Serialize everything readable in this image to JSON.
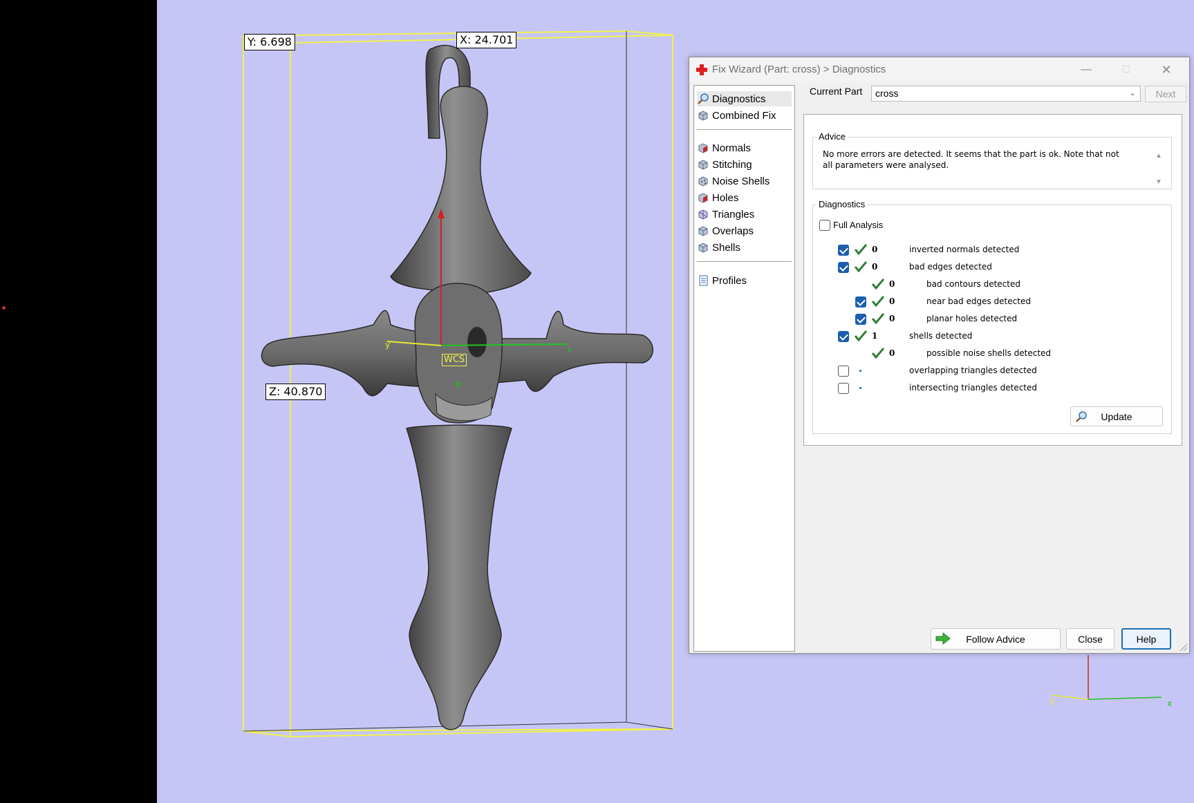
{
  "viewport": {
    "dim_y": "Y: 6.698",
    "dim_x": "X: 24.701",
    "dim_z": "Z: 40.870",
    "wcs_label": "WCS",
    "axis_y": "y",
    "axis_x": "x",
    "mini_axis_x": "x",
    "mini_axis_y": "y"
  },
  "dialog": {
    "title": "Fix Wizard (Part: cross) > Diagnostics",
    "window_buttons": {
      "minimize": "—",
      "maximize": "□",
      "close": "✕"
    }
  },
  "sidebar": {
    "items": [
      {
        "label": "Diagnostics",
        "icon": "magnifier-icon",
        "selected": true
      },
      {
        "label": "Combined Fix",
        "icon": "combined-fix-icon"
      },
      {
        "label": "Normals",
        "icon": "normals-icon"
      },
      {
        "label": "Stitching",
        "icon": "stitching-icon"
      },
      {
        "label": "Noise Shells",
        "icon": "noise-shells-icon"
      },
      {
        "label": "Holes",
        "icon": "holes-icon"
      },
      {
        "label": "Triangles",
        "icon": "triangles-icon"
      },
      {
        "label": "Overlaps",
        "icon": "overlaps-icon"
      },
      {
        "label": "Shells",
        "icon": "shells-icon"
      },
      {
        "label": "Profiles",
        "icon": "profiles-icon"
      }
    ]
  },
  "top": {
    "current_part_label": "Current Part",
    "current_part_value": "cross",
    "next_label": "Next"
  },
  "advice": {
    "title": "Advice",
    "text": "No more errors are detected. It seems that the part is ok. Note that not all parameters were analysed."
  },
  "diagnostics": {
    "title": "Diagnostics",
    "full_analysis_label": "Full Analysis",
    "full_analysis_checked": false,
    "rows": [
      {
        "checkbox": "checked",
        "status": "ok",
        "count": "0",
        "label": "inverted normals detected",
        "indent": 0
      },
      {
        "checkbox": "checked",
        "status": "ok",
        "count": "0",
        "label": "bad edges detected",
        "indent": 0
      },
      {
        "checkbox": "none",
        "status": "ok",
        "count": "0",
        "label": "bad contours detected",
        "indent": 1
      },
      {
        "checkbox": "checked",
        "status": "ok",
        "count": "0",
        "label": "near bad edges detected",
        "indent": 1
      },
      {
        "checkbox": "checked",
        "status": "ok",
        "count": "0",
        "label": "planar holes detected",
        "indent": 1
      },
      {
        "checkbox": "checked",
        "status": "ok",
        "count": "1",
        "label": "shells detected",
        "indent": 0
      },
      {
        "checkbox": "none",
        "status": "ok",
        "count": "0",
        "label": "possible noise shells detected",
        "indent": 1
      },
      {
        "checkbox": "unchecked",
        "status": "pending",
        "count": "",
        "label": "overlapping triangles detected",
        "indent": 0
      },
      {
        "checkbox": "unchecked",
        "status": "pending",
        "count": "",
        "label": "intersecting triangles detected",
        "indent": 0
      }
    ],
    "update_label": "Update"
  },
  "footer": {
    "follow_advice_label": "Follow Advice",
    "close_label": "Close",
    "help_label": "Help"
  },
  "colors": {
    "background": "#c6c6f6",
    "bounding_box": "#f2f24a",
    "tick_green": "#2f7d3a",
    "checkbox_blue": "#1b5fae",
    "accent_red": "#e02020"
  }
}
